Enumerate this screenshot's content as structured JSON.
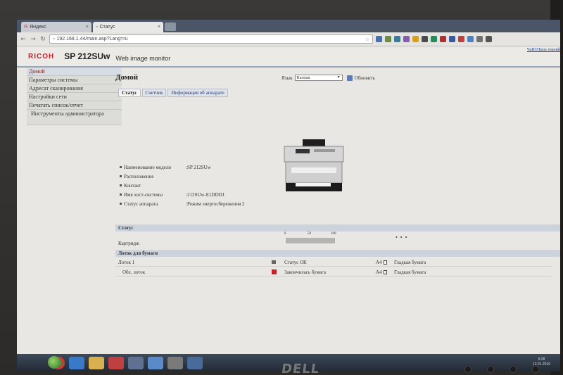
{
  "browser": {
    "tabs": [
      {
        "label": "Яндекс",
        "active": false
      },
      {
        "label": "Статус",
        "active": true
      }
    ],
    "url": "192.168.1.44/main.asp?Lang=ru"
  },
  "header": {
    "brand": "RICOH",
    "model": "SP 212SUw",
    "subtitle": "Web image monitor",
    "help_link": "ЧаВО/База знаний"
  },
  "sidebar": {
    "items": [
      {
        "label": "Домой"
      },
      {
        "label": "Параметры системы"
      },
      {
        "label": "Адресат сканирования"
      },
      {
        "label": "Настройки сети"
      },
      {
        "label": "Печатать список/отчет"
      },
      {
        "label": "Инструменты администратора"
      }
    ]
  },
  "main": {
    "title": "Домой",
    "language_label": "Язык",
    "language_value": "Russian",
    "refresh_label": "Обновить",
    "tabs": [
      {
        "label": "Статус",
        "active": true
      },
      {
        "label": "Счетчик",
        "active": false
      },
      {
        "label": "Информация об аппарате",
        "active": false
      }
    ],
    "info": [
      {
        "label": "Наименование модели",
        "value": ":SP 212SUw"
      },
      {
        "label": "Расположение",
        "value": ""
      },
      {
        "label": "Контакт",
        "value": ""
      },
      {
        "label": "Имя хост-системы",
        "value": ":212SUw-E1DDD1"
      },
      {
        "label": "Статус аппарата",
        "value": ":Режим энергосбережения 2"
      }
    ],
    "status_section": {
      "title": "Статус",
      "scale": [
        "0",
        "50",
        "100"
      ],
      "cartridge_label": "Картридж",
      "cartridge_dots": "• • •"
    },
    "trays_section": {
      "title": "Лоток для бумаги",
      "rows": [
        {
          "name": "Лоток 1",
          "status": "Статус ОК",
          "size": "A4",
          "type": "Гладкая бумага"
        },
        {
          "name": "Обх. лоток",
          "status": "Закончилась бумага",
          "size": "A4",
          "type": "Гладкая бумага"
        }
      ]
    }
  },
  "taskbar": {
    "time": "9:28",
    "date": "12.01.2016"
  },
  "bezel": {
    "brand": "DELL"
  }
}
